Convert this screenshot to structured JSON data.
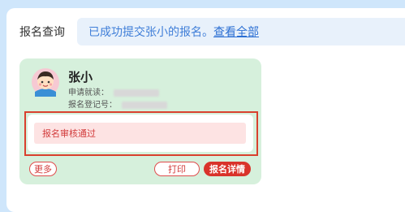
{
  "query": {
    "label": "报名查询",
    "message": "已成功提交张小的报名。",
    "view_all_link": "查看全部"
  },
  "card": {
    "name": "张小",
    "school_label": "申请就读：",
    "reg_no_label": "报名登记号：",
    "status": "报名审核通过",
    "more_button": "更多",
    "print_button": "打印",
    "detail_button": "报名详情"
  },
  "colors": {
    "background": "#cfe6fb",
    "card": "#d6f0dc",
    "accent_red": "#d9332b",
    "link_blue": "#2b6fd3"
  }
}
